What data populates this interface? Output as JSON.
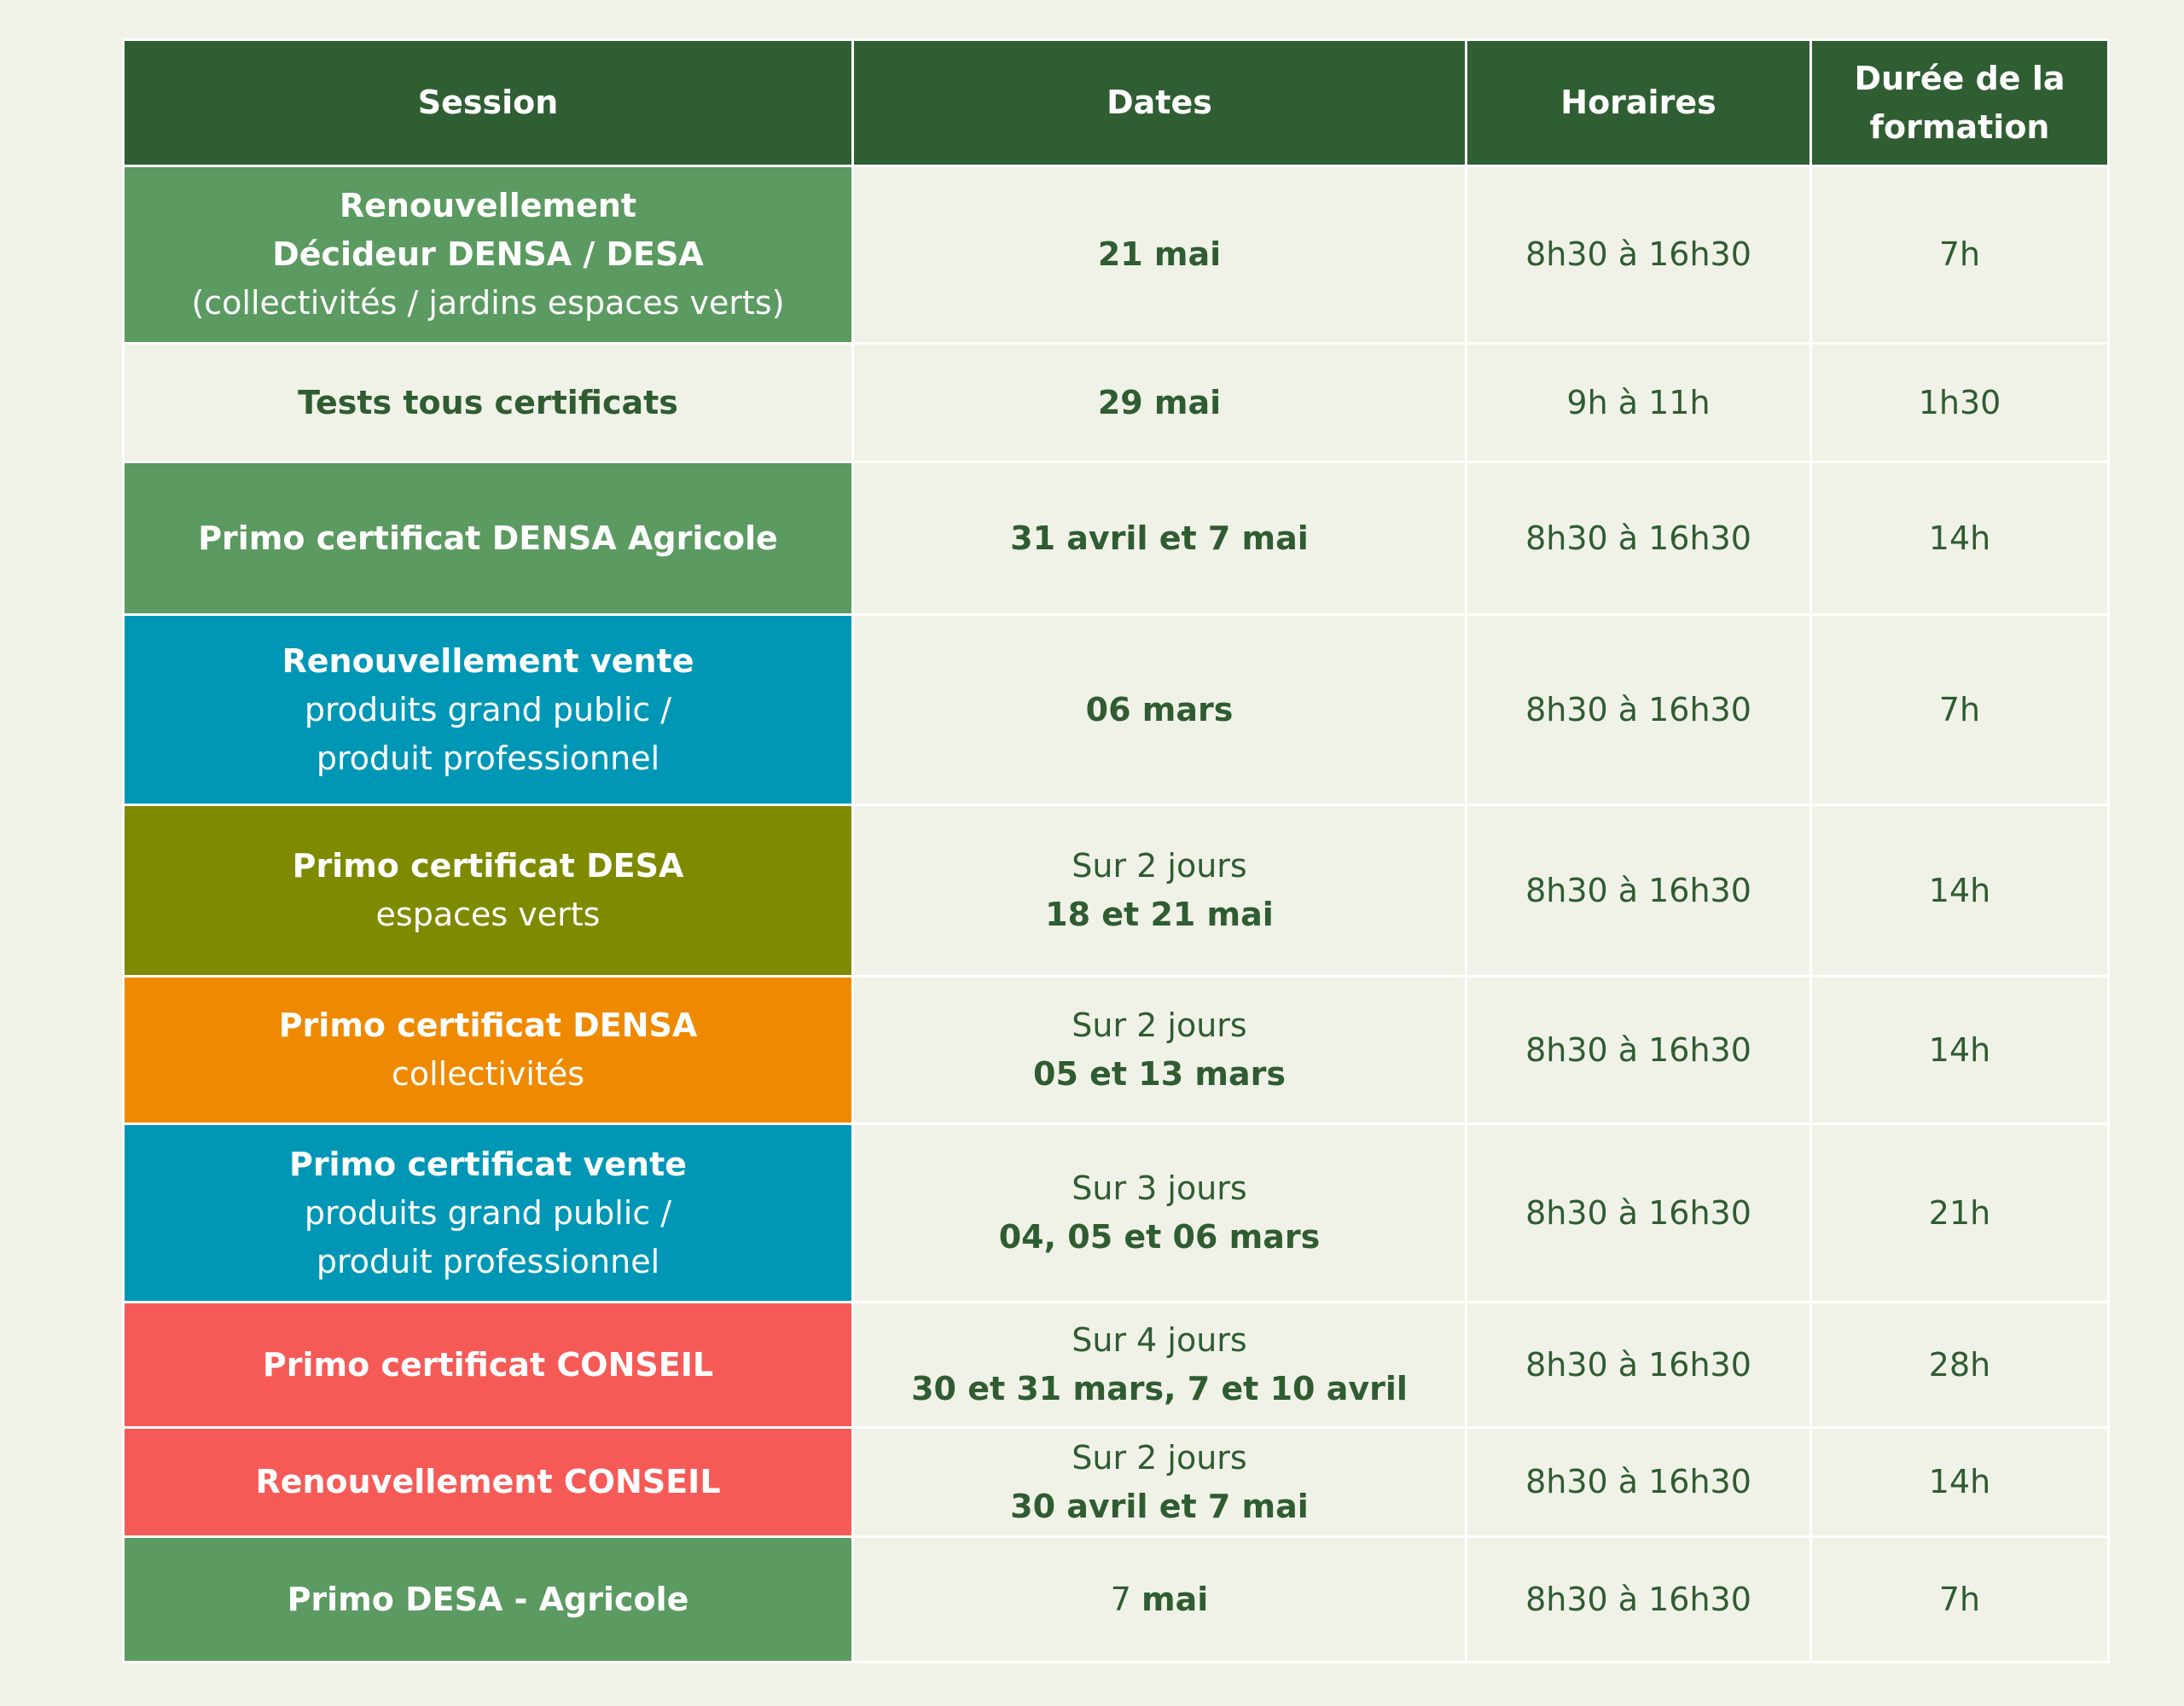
{
  "headers": {
    "session": "Session",
    "dates": "Dates",
    "horaires": "Horaires",
    "duree_line1": "Durée de la",
    "duree_line2": "formation"
  },
  "colors": {
    "header": "#305e33",
    "green": "#5b9a60",
    "blue": "#0097b6",
    "olive": "#7e8a00",
    "orange": "#ef8a00",
    "red": "#f65a57",
    "text_dark": "#2f5c31",
    "background": "#f0f2e8"
  },
  "rows": [
    {
      "session_bold_1": "Renouvellement",
      "session_bold_2": "Décideur DENSA / DESA",
      "session_normal": "(collectivités / jardins espaces verts)",
      "dates_bold": "21 mai",
      "horaires": "8h30 à 16h30",
      "duree": "7h"
    },
    {
      "session_bold": "Tests tous certificats",
      "dates_bold": "29 mai",
      "horaires": "9h à 11h",
      "duree": "1h30"
    },
    {
      "session_bold": "Primo certificat DENSA Agricole",
      "dates_bold": "31 avril et 7 mai",
      "horaires": "8h30 à 16h30",
      "duree": "14h"
    },
    {
      "session_bold": "Renouvellement vente",
      "session_normal_1": "produits grand public /",
      "session_normal_2": "produit professionnel",
      "dates_bold": "06 mars",
      "horaires": "8h30 à 16h30",
      "duree": "7h"
    },
    {
      "session_bold": "Primo certificat DESA",
      "session_normal": "espaces verts",
      "dates_normal": "Sur 2 jours",
      "dates_bold": "18 et 21 mai",
      "horaires": "8h30 à 16h30",
      "duree": "14h"
    },
    {
      "session_bold": "Primo certificat DENSA",
      "session_normal": "collectivités",
      "dates_normal": "Sur 2 jours",
      "dates_bold": "05 et 13 mars",
      "horaires": "8h30 à 16h30",
      "duree": "14h"
    },
    {
      "session_bold": "Primo certificat vente",
      "session_normal_1": "produits grand public /",
      "session_normal_2": "produit professionnel",
      "dates_normal": "Sur 3 jours",
      "dates_bold": "04, 05 et 06 mars",
      "horaires": "8h30 à 16h30",
      "duree": "21h"
    },
    {
      "session_bold": "Primo certificat CONSEIL",
      "dates_normal": "Sur 4 jours",
      "dates_bold": "30 et 31 mars, 7 et 10 avril",
      "horaires": "8h30 à 16h30",
      "duree": "28h"
    },
    {
      "session_bold": "Renouvellement CONSEIL",
      "dates_normal": "Sur 2 jours",
      "dates_bold": "30 avril et 7 mai",
      "horaires": "8h30 à 16h30",
      "duree": "14h"
    },
    {
      "session_bold": "Primo DESA - Agricole",
      "dates_normal": "7",
      "dates_bold": "mai",
      "horaires": "8h30 à 16h30",
      "duree": "7h"
    }
  ]
}
